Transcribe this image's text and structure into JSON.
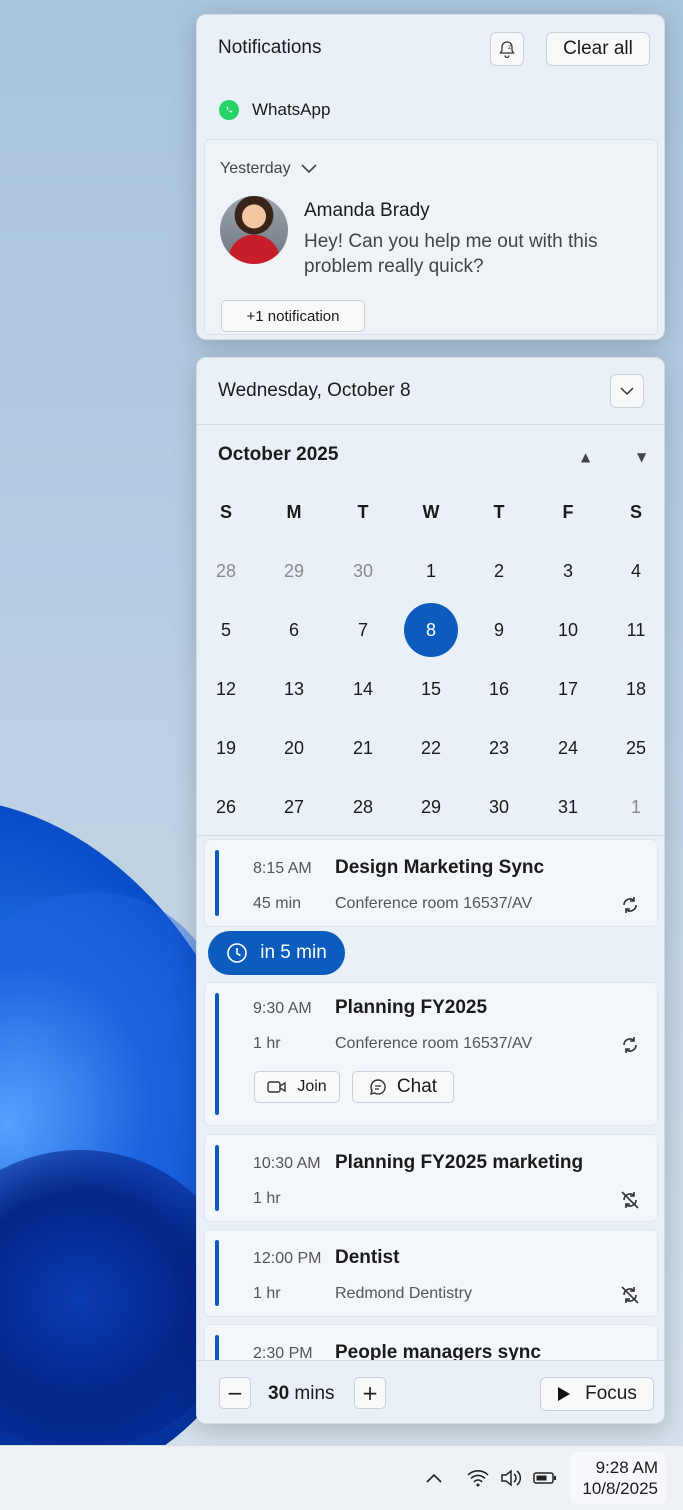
{
  "notifications": {
    "title": "Notifications",
    "clear_all_label": "Clear all",
    "app_name": "WhatsApp",
    "group_label": "Yesterday",
    "sender": "Amanda Brady",
    "message": "Hey! Can you help me out with this problem really quick?",
    "more_label": "+1 notification"
  },
  "calendar": {
    "date_header": "Wednesday, October 8",
    "month_label": "October 2025",
    "weekdays": [
      "S",
      "M",
      "T",
      "W",
      "T",
      "F",
      "S"
    ],
    "weeks": [
      [
        "28",
        "29",
        "30",
        "1",
        "2",
        "3",
        "4"
      ],
      [
        "5",
        "6",
        "7",
        "8",
        "9",
        "10",
        "11"
      ],
      [
        "12",
        "13",
        "14",
        "15",
        "16",
        "17",
        "18"
      ],
      [
        "19",
        "20",
        "21",
        "22",
        "23",
        "24",
        "25"
      ],
      [
        "26",
        "27",
        "28",
        "29",
        "30",
        "31",
        "1"
      ]
    ],
    "selected_day": "8"
  },
  "agenda": {
    "countdown": "in 5 min",
    "join_label": "Join",
    "chat_label": "Chat",
    "events": [
      {
        "time": "8:15 AM",
        "title": "Design Marketing Sync",
        "duration": "45 min",
        "location": "Conference room 16537/AV",
        "recurrence": "recurring"
      },
      {
        "time": "9:30 AM",
        "title": "Planning FY2025",
        "duration": "1 hr",
        "location": "Conference room 16537/AV",
        "recurrence": "recurring"
      },
      {
        "time": "10:30 AM",
        "title": "Planning FY2025 marketing",
        "duration": "1 hr",
        "location": "",
        "recurrence": "non-recurring"
      },
      {
        "time": "12:00 PM",
        "title": "Dentist",
        "duration": "1 hr",
        "location": "Redmond Dentistry",
        "recurrence": "non-recurring"
      },
      {
        "time": "2:30 PM",
        "title": "People managers sync",
        "duration": "",
        "location": "",
        "recurrence": ""
      }
    ]
  },
  "focus": {
    "minutes_value": "30",
    "minutes_unit": "mins",
    "focus_label": "Focus"
  },
  "taskbar": {
    "time": "9:28 AM",
    "date": "10/8/2025"
  },
  "colors": {
    "accent": "#0b5cbd",
    "whatsapp": "#25d366"
  }
}
